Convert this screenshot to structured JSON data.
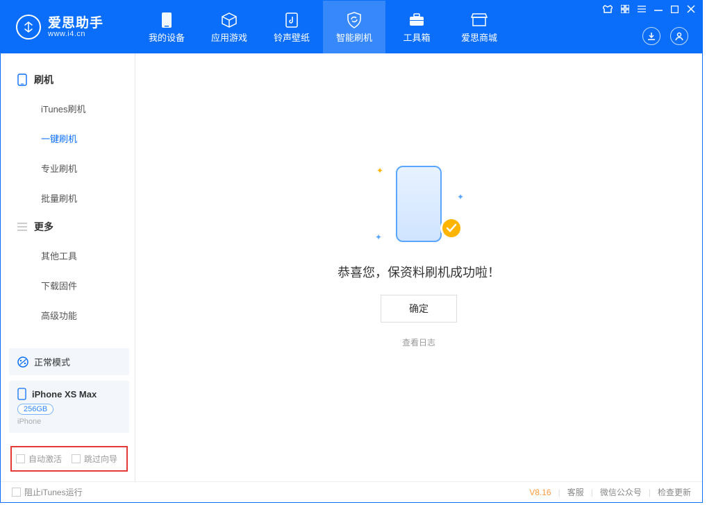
{
  "app": {
    "name": "爱思助手",
    "url": "www.i4.cn"
  },
  "nav": [
    {
      "label": "我的设备"
    },
    {
      "label": "应用游戏"
    },
    {
      "label": "铃声壁纸"
    },
    {
      "label": "智能刷机"
    },
    {
      "label": "工具箱"
    },
    {
      "label": "爱思商城"
    }
  ],
  "sidebar": {
    "group1": {
      "title": "刷机",
      "items": [
        "iTunes刷机",
        "一键刷机",
        "专业刷机",
        "批量刷机"
      ]
    },
    "group2": {
      "title": "更多",
      "items": [
        "其他工具",
        "下载固件",
        "高级功能"
      ]
    }
  },
  "device": {
    "mode": "正常模式",
    "name": "iPhone XS Max",
    "capacity": "256GB",
    "type": "iPhone"
  },
  "options": {
    "auto_activate": "自动激活",
    "skip_guide": "跳过向导"
  },
  "main": {
    "success": "恭喜您，保资料刷机成功啦！",
    "confirm": "确定",
    "view_log": "查看日志"
  },
  "footer": {
    "block_itunes": "阻止iTunes运行",
    "version": "V8.16",
    "links": [
      "客服",
      "微信公众号",
      "检查更新"
    ]
  }
}
